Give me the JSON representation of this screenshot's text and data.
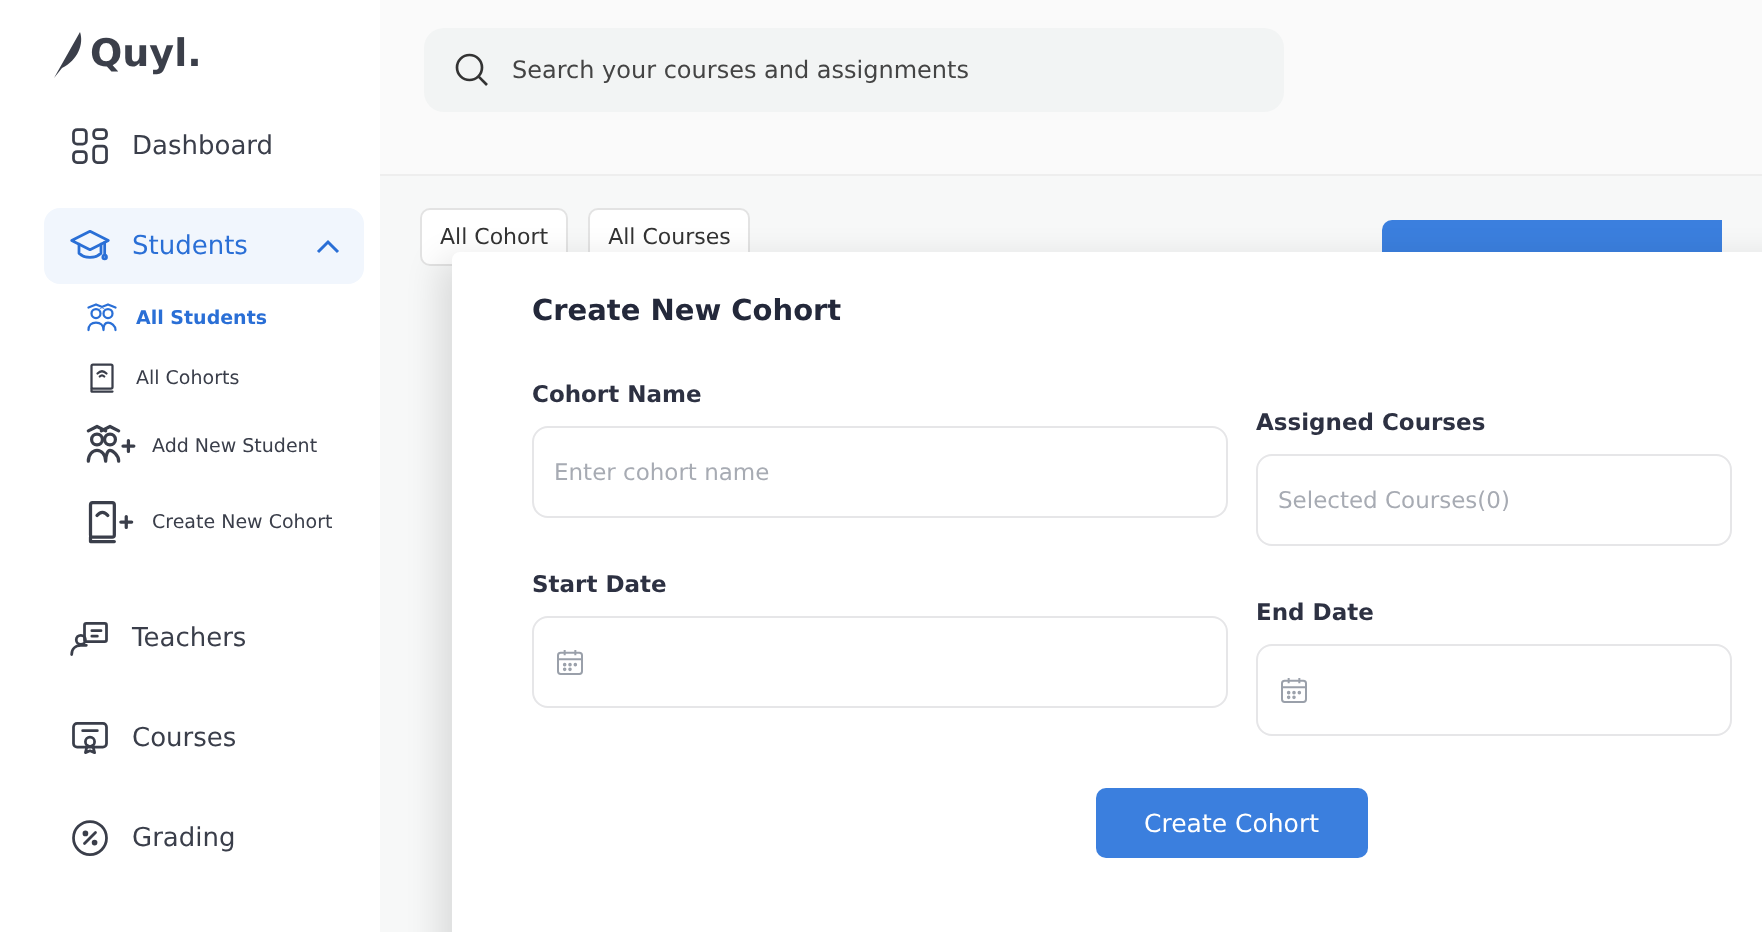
{
  "logo": {
    "text": "Quyl."
  },
  "nav": [
    {
      "label": "Dashboard",
      "selected": false
    },
    {
      "label": "Students",
      "selected": true,
      "expanded": true,
      "children": [
        {
          "label": "All Students",
          "selected": true
        },
        {
          "label": "All Cohorts",
          "selected": false
        },
        {
          "label": "Add New Student",
          "selected": false
        },
        {
          "label": "Create New Cohort",
          "selected": false
        }
      ]
    },
    {
      "label": "Teachers",
      "selected": false
    },
    {
      "label": "Courses",
      "selected": false
    },
    {
      "label": "Grading",
      "selected": false
    }
  ],
  "search": {
    "placeholder": "Search your courses and assignments"
  },
  "filters": [
    {
      "label": "All Cohort"
    },
    {
      "label": "All Courses"
    }
  ],
  "modal": {
    "title": "Create New Cohort",
    "fields": [
      {
        "kind": "text",
        "label": "Cohort Name",
        "placeholder": "Enter cohort name"
      },
      {
        "kind": "select",
        "label": "Assigned Courses",
        "placeholder": "Selected Courses(0)"
      },
      {
        "kind": "date",
        "label": "Start Date"
      },
      {
        "kind": "date",
        "label": "End Date"
      }
    ],
    "submit": "Create  Cohort"
  }
}
